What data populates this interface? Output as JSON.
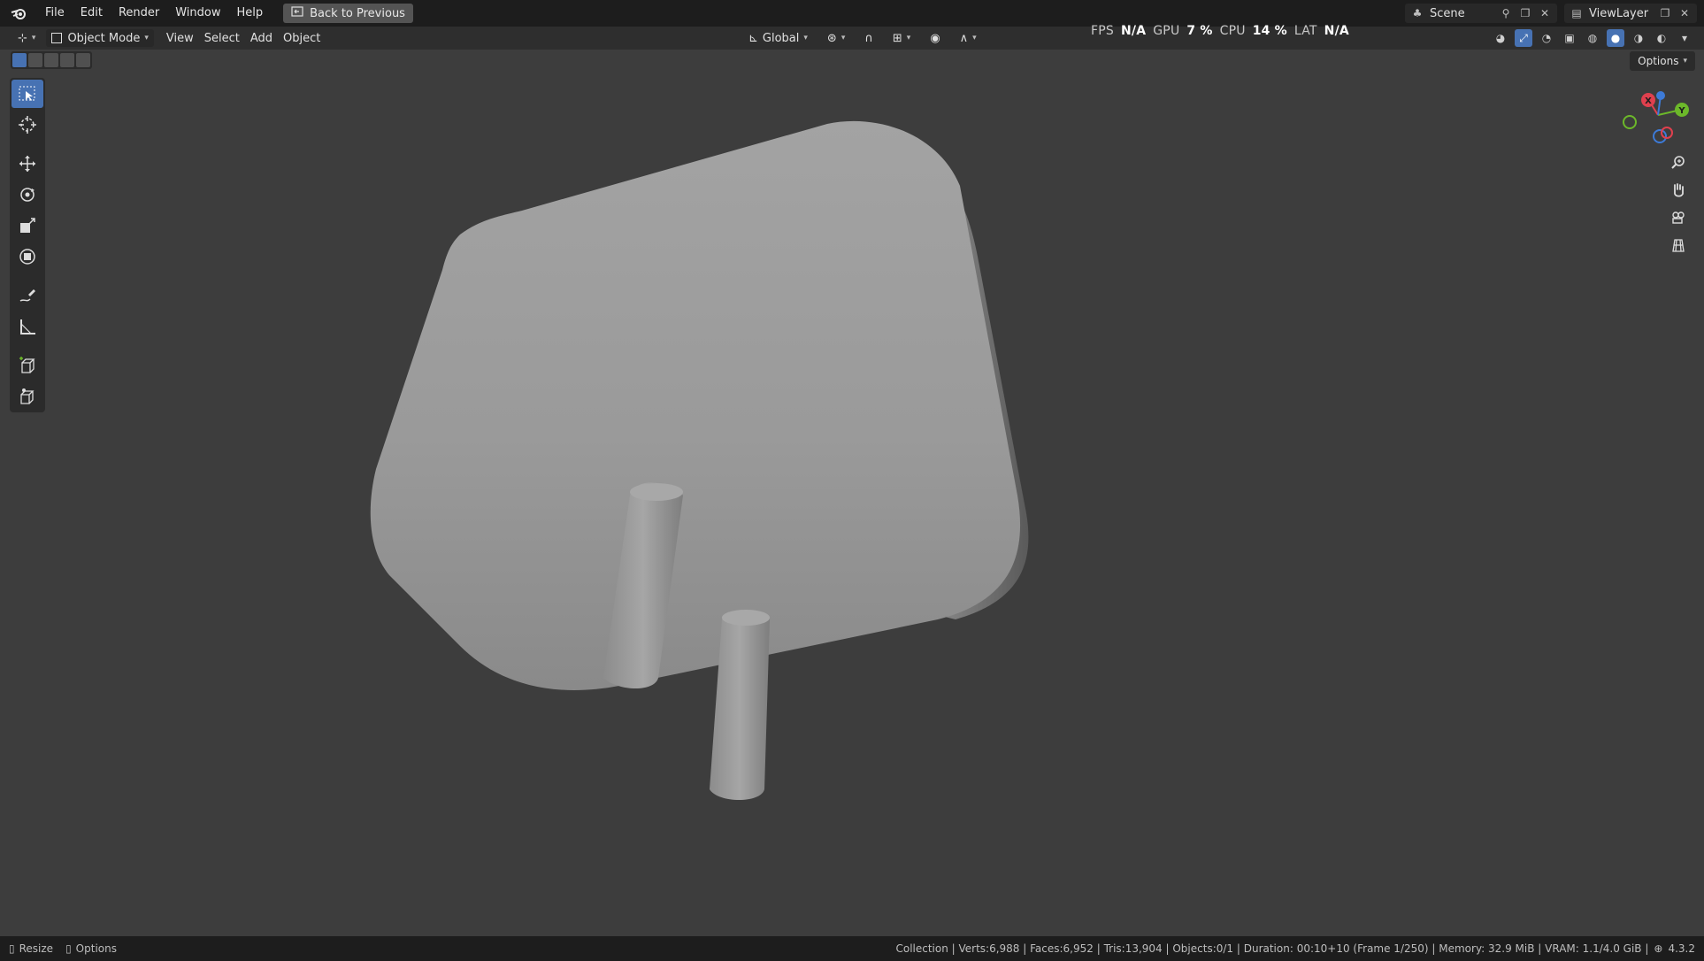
{
  "menu": {
    "items": [
      "File",
      "Edit",
      "Render",
      "Window",
      "Help"
    ],
    "back_button": "Back to Previous"
  },
  "topbar_right": {
    "scene": "Scene",
    "view_layer": "ViewLayer"
  },
  "header": {
    "mode": "Object Mode",
    "menus": [
      "View",
      "Select",
      "Add",
      "Object"
    ],
    "transform_orientation": "Global",
    "options": "Options"
  },
  "perf": {
    "fps_label": "FPS",
    "fps_value": "N/A",
    "gpu_label": "GPU",
    "gpu_value": "7 %",
    "cpu_label": "CPU",
    "cpu_value": "14 %",
    "lat_label": "LAT",
    "lat_value": "N/A"
  },
  "gizmo": {
    "x": "X",
    "y": "Y",
    "x_color": "#e0404e",
    "y_color": "#6cb82a",
    "z_color": "#3d7bd8"
  },
  "status": {
    "left_1": "Resize",
    "left_2": "Options",
    "stats": "Collection | Verts:6,988 | Faces:6,952 | Tris:13,904 | Objects:0/1 | Duration: 00:10+10 (Frame 1/250) | Memory: 32.9 MiB | VRAM: 1.1/4.0 GiB |",
    "version": "4.3.2"
  },
  "colors": {
    "accent": "#4772b3",
    "viewport_bg": "#3d3d3d",
    "object": "#9a9a9a"
  }
}
